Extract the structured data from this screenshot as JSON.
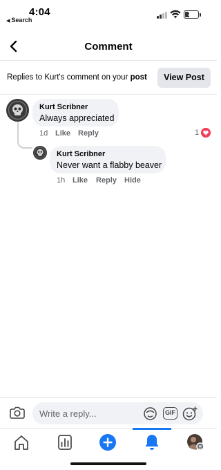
{
  "status": {
    "time": "4:04",
    "back_label": "Search",
    "battery_level": "35",
    "battery_fraction": 0.35
  },
  "header": {
    "title": "Comment",
    "back_icon": "chevron-left-icon"
  },
  "context": {
    "text": "Replies to Kurt's comment on your ",
    "text_emphasis": "post",
    "button_label": "View Post"
  },
  "comments": [
    {
      "author": "Kurt Scribner",
      "text": "Always appreciated",
      "time": "1d",
      "like_label": "Like",
      "reply_label": "Reply",
      "reaction_count": "1",
      "reaction_icon": "love-reaction-icon"
    },
    {
      "author": "Kurt Scribner",
      "text": "Never want a flabby beaver",
      "time": "1h",
      "like_label": "Like",
      "reply_label": "Reply",
      "hide_label": "Hide"
    }
  ],
  "composer": {
    "placeholder": "Write a reply...",
    "gif_label": "GIF",
    "icons": [
      "camera-icon",
      "avatar-sticker-icon",
      "gif-icon",
      "emoji-icon"
    ]
  },
  "tabbar": {
    "items": [
      "home-icon",
      "dashboard-icon",
      "create-plus-icon",
      "notifications-bell-icon",
      "profile-avatar"
    ],
    "active": "notifications-bell-icon"
  },
  "colors": {
    "accent": "#1877f2",
    "bubble": "#f0f2f5",
    "secondary_text": "#65676b",
    "love": "#f33e58"
  }
}
